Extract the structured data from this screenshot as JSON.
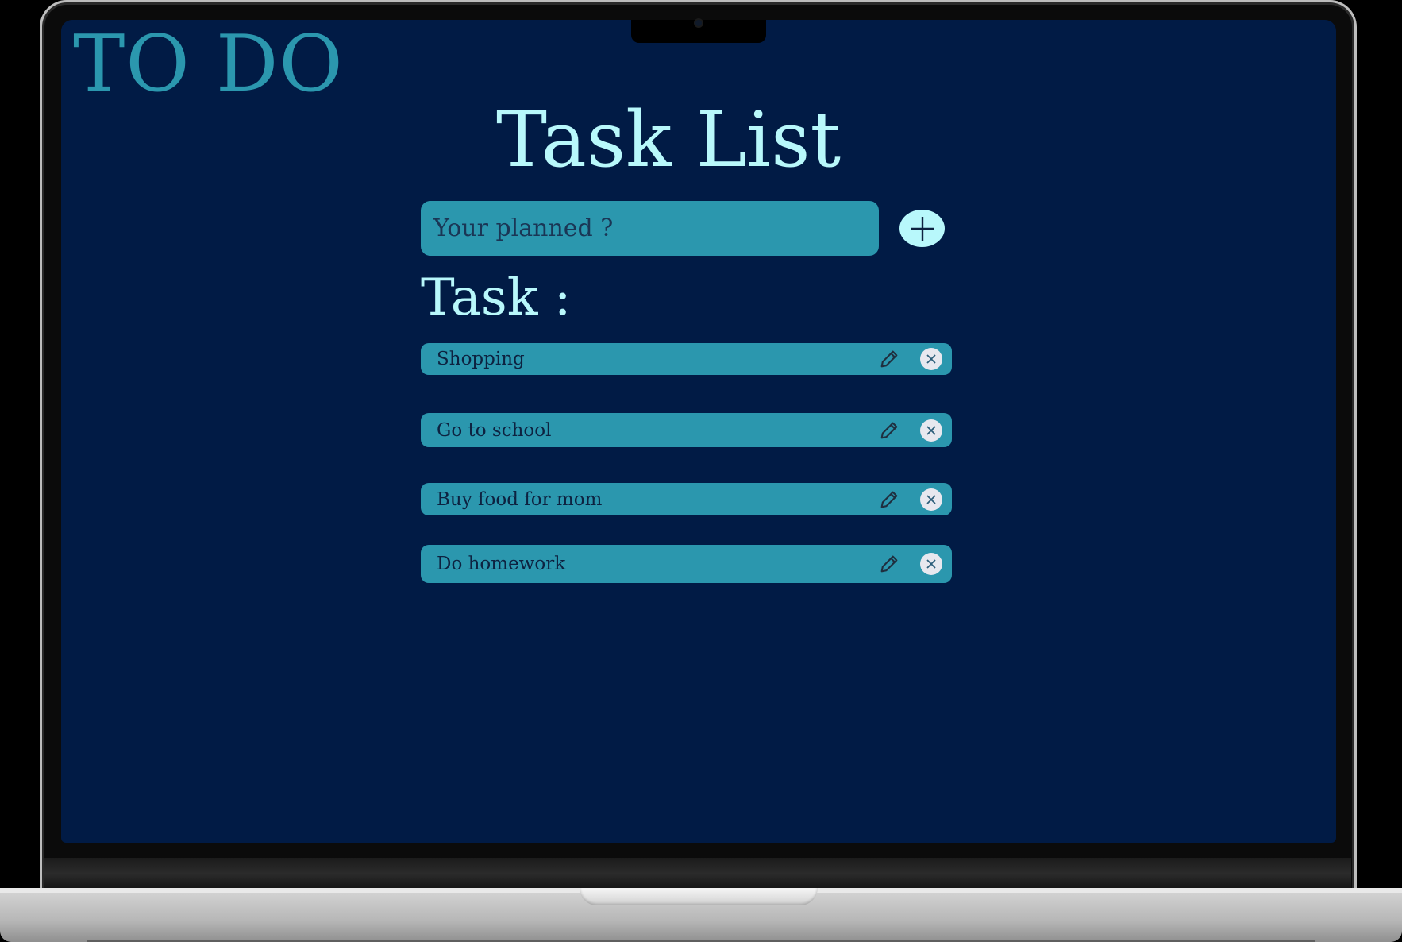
{
  "app": {
    "brand": "TO DO",
    "title": "Task List"
  },
  "input": {
    "placeholder": "Your planned ?",
    "value": ""
  },
  "add_button": {
    "icon": "plus-icon"
  },
  "section_label": "Task :",
  "tasks": [
    {
      "text": "Shopping"
    },
    {
      "text": "Go to school"
    },
    {
      "text": "Buy food for mom"
    },
    {
      "text": "Do homework"
    }
  ],
  "task_actions": {
    "edit_icon": "pencil-icon",
    "delete_icon": "close-circle-icon"
  },
  "colors": {
    "screen_background": "#011b45",
    "accent": "#2b97ae",
    "heading": "#b8f8fb",
    "task_text": "#0d2240",
    "delete_icon_bg": "#e7e8ef"
  }
}
